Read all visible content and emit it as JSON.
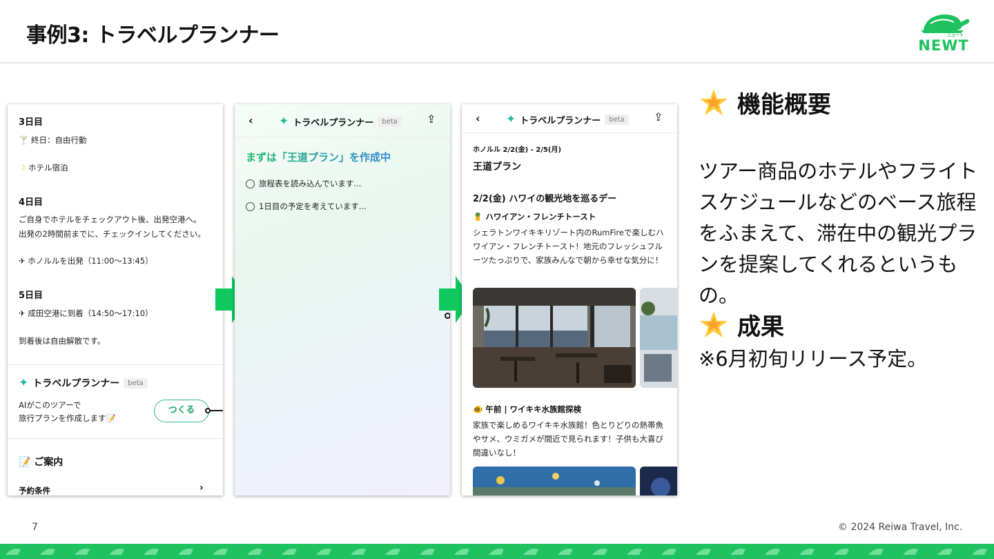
{
  "slide": {
    "title": "事例3: トラベルプランナー",
    "logo_text": "NEWT",
    "logo_kana": "ニュート",
    "page_number": "7",
    "copyright": "© 2024 Reiwa Travel, Inc."
  },
  "phone1": {
    "day3_title": "3日目",
    "day3_free": "終日：自由行動",
    "day3_hotel": "ホテル宿泊",
    "day4_title": "4日目",
    "day4_line1": "ご自身でホテルをチェックアウト後、出発空港へ。",
    "day4_line2": "出発の2時間前までに、チェックインしてください。",
    "day4_flight": "ホノルルを出発（11:00〜13:45）",
    "day5_title": "5日目",
    "day5_flight": "成田空港に到着（14:50〜17:10）",
    "day5_after": "到着後は自由解散です。",
    "planner_title": "トラベルプランナー",
    "beta": "beta",
    "ai_line1": "AIがこのツアーで",
    "ai_line2": "旅行プランを作成します",
    "create_button": "つくる",
    "guide_title": "ご案内",
    "conditions": "予約条件"
  },
  "phone2": {
    "nav_title": "トラベルプランナー",
    "beta": "beta",
    "creating": "まずは「王道プラン」を作成中",
    "task1": "旅程表を読み込んでいます...",
    "task2": "1日目の予定を考えています..."
  },
  "phone3": {
    "nav_title": "トラベルプランナー",
    "beta": "beta",
    "breadcrumb": "ホノルル 2/2(金) - 2/5(月)",
    "plan_name": "王道プラン",
    "day_title": "2/2(金) ハワイの観光地を巡るデー",
    "spot1": "ハワイアン・フレンチトースト",
    "spot1_desc": "シェラトンワイキキリゾート内のRumFireで楽しむハワイアン・フレンチトースト！地元のフレッシュフルーツたっぷりで、家族みんなで朝から幸せな気分に！",
    "spot2": "午前 | ワイキキ水族館探検",
    "spot2_desc": "家族で楽しめるワイキキ水族館！色とりどりの熱帯魚やサメ、ウミガメが間近で見られます！子供も大喜び間違いなし！"
  },
  "right": {
    "section1_title": "機能概要",
    "section1_body": "ツアー商品のホテルやフライトスケジュールなどのベース旅程をふまえて、滞在中の観光プランを提案してくれるというもの。",
    "section2_title": "成果",
    "section2_note": "※6月初旬リリース予定。"
  },
  "colors": {
    "brand_green": "#1ec25f",
    "arrow_green": "#0fc85e"
  }
}
